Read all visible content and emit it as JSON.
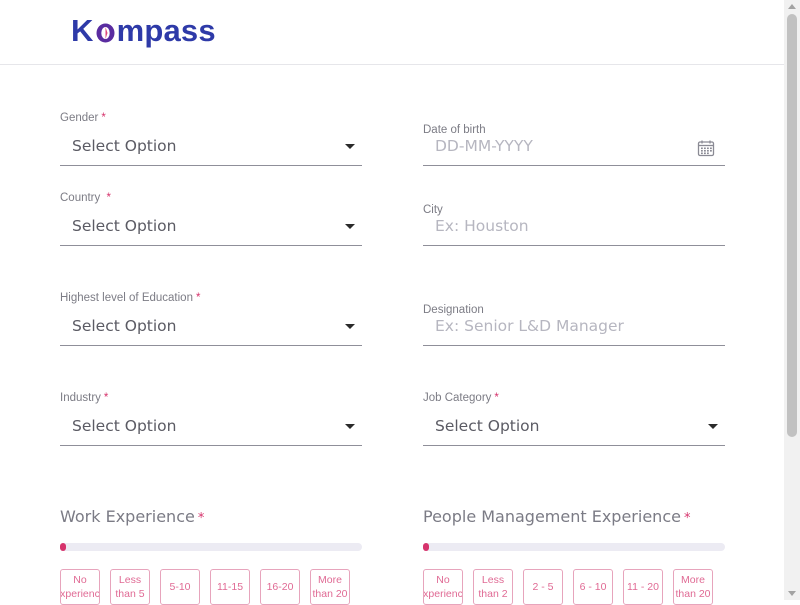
{
  "header": {
    "logo_text_before": "K",
    "logo_text_after": "mpass",
    "brand_colors": {
      "primary": "#2e3aa8",
      "accent": "#d6336c"
    }
  },
  "form": {
    "gender": {
      "label": "Gender",
      "required": "*",
      "value": "Select Option"
    },
    "dob": {
      "label": "Date of birth",
      "placeholder": "DD-MM-YYYY",
      "icon": "calendar-icon"
    },
    "country": {
      "label": "Country",
      "required": "*",
      "value": "Select Option"
    },
    "city": {
      "label": "City",
      "placeholder": "Ex: Houston"
    },
    "education": {
      "label": "Highest level of Education",
      "required": "*",
      "value": "Select Option"
    },
    "designation": {
      "label": "Designation",
      "placeholder": "Ex: Senior L&D Manager"
    },
    "industry": {
      "label": "Industry",
      "required": "*",
      "value": "Select Option"
    },
    "job_category": {
      "label": "Job Category",
      "required": "*",
      "value": "Select Option"
    }
  },
  "work_experience": {
    "title": "Work Experience",
    "required": "*",
    "progress": 0,
    "options": [
      "No experience",
      "Less than 5",
      "5-10",
      "11-15",
      "16-20",
      "More than 20"
    ]
  },
  "people_management": {
    "title": "People Management Experience",
    "required": "*",
    "progress": 0,
    "options": [
      "No experience",
      "Less than 2",
      "2 - 5",
      "6 - 10",
      "11 - 20",
      "More than 20"
    ]
  }
}
